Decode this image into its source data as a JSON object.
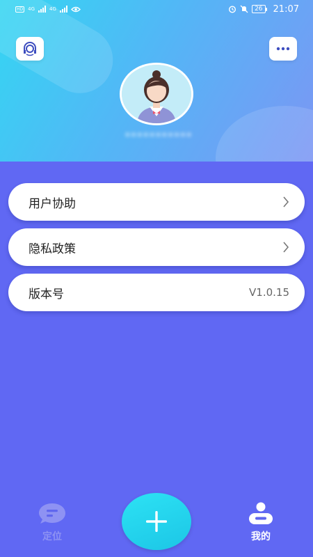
{
  "status_bar": {
    "left_badges": [
      "HD",
      "HD"
    ],
    "network_labels": [
      "4G",
      "4G"
    ],
    "battery": "26",
    "time": "21:07"
  },
  "header": {
    "username": "•••••••••••"
  },
  "menu": {
    "items": [
      {
        "label": "用户协助"
      },
      {
        "label": "隐私政策"
      },
      {
        "label": "版本号",
        "value": "V1.0.15"
      }
    ]
  },
  "bottom_nav": {
    "locate_label": "定位",
    "mine_label": "我的"
  },
  "colors": {
    "background": "#6068f3",
    "fab": "#1fcbe9",
    "nav_inactive": "#8e92f3",
    "nav_active": "#ffffff"
  },
  "icons": {
    "support": "headset-icon",
    "more": "ellipsis-icon",
    "avatar": "user-avatar",
    "chevron": "chevron-right-icon",
    "locate": "chat-bubble-icon",
    "add": "plus-icon",
    "mine": "user-icon"
  }
}
